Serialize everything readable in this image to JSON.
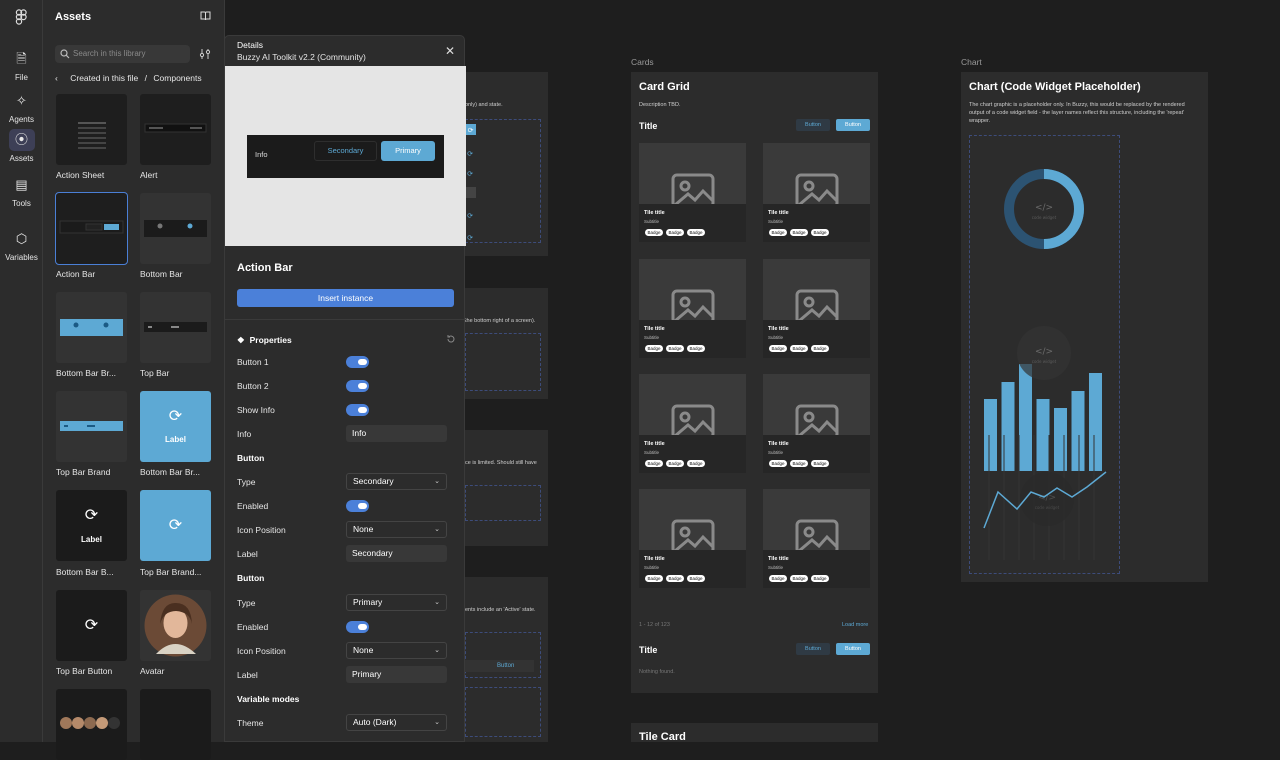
{
  "rail": {
    "items": [
      {
        "label": "File",
        "icon": "file-icon"
      },
      {
        "label": "Agents",
        "icon": "agents-icon"
      },
      {
        "label": "Assets",
        "icon": "assets-icon"
      },
      {
        "label": "Tools",
        "icon": "tools-icon"
      },
      {
        "label": "Variables",
        "icon": "variables-icon"
      }
    ]
  },
  "assets": {
    "title": "Assets",
    "search_placeholder": "Search in this library",
    "breadcrumb_parent": "Created in this file",
    "breadcrumb_sep": "/",
    "breadcrumb_current": "Components",
    "tiles": [
      {
        "label": "Action Sheet"
      },
      {
        "label": "Alert"
      },
      {
        "label": "Action Bar"
      },
      {
        "label": "Bottom Bar"
      },
      {
        "label": "Bottom Bar Br..."
      },
      {
        "label": "Top Bar"
      },
      {
        "label": "Top Bar Brand"
      },
      {
        "label": "Bottom Bar Br..."
      },
      {
        "label": "Bottom Bar B..."
      },
      {
        "label": "Top Bar Brand..."
      },
      {
        "label": "Top Bar Button"
      },
      {
        "label": "Avatar"
      }
    ],
    "tile_texts": {
      "label": "Label",
      "top_bar": "Top",
      "info": "Info",
      "secondary": "Secondary",
      "primary": "Primary"
    }
  },
  "details": {
    "header": "Details",
    "library": "Buzzy AI Toolkit v2.2 (Community)",
    "preview": {
      "info": "Info",
      "secondary": "Secondary",
      "primary": "Primary"
    },
    "component_name": "Action Bar",
    "insert_label": "Insert instance",
    "properties_label": "Properties",
    "props": {
      "button1": {
        "label": "Button 1"
      },
      "button2": {
        "label": "Button 2"
      },
      "show_info": {
        "label": "Show Info"
      },
      "info": {
        "label": "Info",
        "value": "Info"
      },
      "button_a": {
        "heading": "Button",
        "type_label": "Type",
        "type_value": "Secondary",
        "enabled_label": "Enabled",
        "icon_pos_label": "Icon Position",
        "icon_pos_value": "None",
        "label_label": "Label",
        "label_value": "Secondary"
      },
      "button_b": {
        "heading": "Button",
        "type_label": "Type",
        "type_value": "Primary",
        "enabled_label": "Enabled",
        "icon_pos_label": "Icon Position",
        "icon_pos_value": "None",
        "label_label": "Label",
        "label_value": "Primary"
      },
      "variable_modes": {
        "heading": "Variable modes",
        "theme_label": "Theme",
        "theme_value": "Auto (Dark)"
      }
    }
  },
  "canvas": {
    "left_frames": {
      "f1_text": "only) and state.",
      "f2_text": "the bottom right of a screen).",
      "f3_text": "ce is limited. Should still have",
      "f4_text": "ents include an 'Active' state.",
      "f4_button": "Button"
    },
    "cards": {
      "section_label": "Cards",
      "title": "Card Grid",
      "description": "Description TBD.",
      "subtitle": "Title",
      "button_label": "Button",
      "tile_title": "Tile title",
      "tile_subtitle": "Subtitle",
      "badge": "Badge",
      "pagination": "1 - 12 of 123",
      "load_more": "Load more",
      "empty_title": "Title",
      "empty_text": "Nothing found.",
      "tile_card_title": "Tile Card"
    },
    "chart": {
      "section_label": "Chart",
      "title": "Chart (Code Widget Placeholder)",
      "desc1": "The chart graphic is a placeholder only. In Buzzy, this would be replaced by the rendered",
      "desc2": "output of a code widget field - the layer names reflect this structure, including the 'repeat'",
      "desc3": "wrapper.",
      "widget_label": "code widget"
    }
  }
}
